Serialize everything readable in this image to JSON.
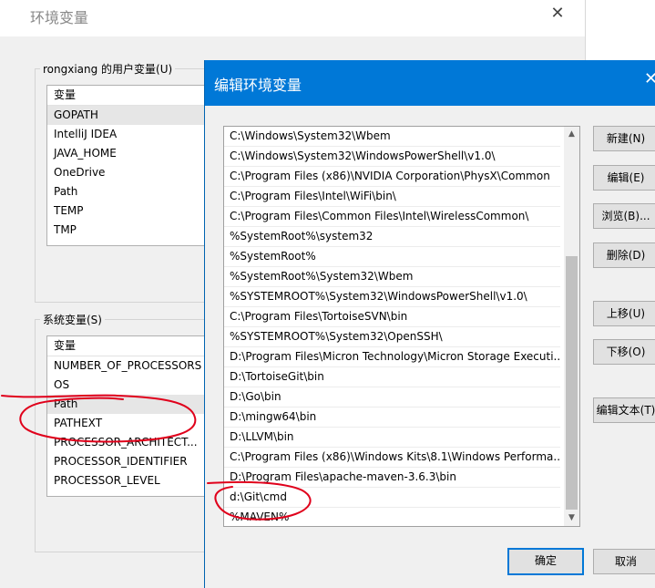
{
  "bg_window": {
    "title": "环境变量",
    "user_vars_label": "rongxiang 的用户变量(U)",
    "user_vars_header": "变量",
    "user_vars": [
      "GOPATH",
      "IntelliJ IDEA",
      "JAVA_HOME",
      "OneDrive",
      "Path",
      "TEMP",
      "TMP"
    ],
    "sys_vars_label": "系统变量(S)",
    "sys_vars_header": "变量",
    "sys_vars": [
      "NUMBER_OF_PROCESSORS",
      "OS",
      "Path",
      "PATHEXT",
      "PROCESSOR_ARCHITECT...",
      "PROCESSOR_IDENTIFIER",
      "PROCESSOR_LEVEL"
    ]
  },
  "dialog": {
    "title": "编辑环境变量",
    "paths": [
      "C:\\Windows\\System32\\Wbem",
      "C:\\Windows\\System32\\WindowsPowerShell\\v1.0\\",
      "C:\\Program Files (x86)\\NVIDIA Corporation\\PhysX\\Common",
      "C:\\Program Files\\Intel\\WiFi\\bin\\",
      "C:\\Program Files\\Common Files\\Intel\\WirelessCommon\\",
      "%SystemRoot%\\system32",
      "%SystemRoot%",
      "%SystemRoot%\\System32\\Wbem",
      "%SYSTEMROOT%\\System32\\WindowsPowerShell\\v1.0\\",
      "C:\\Program Files\\TortoiseSVN\\bin",
      "%SYSTEMROOT%\\System32\\OpenSSH\\",
      "D:\\Program Files\\Micron Technology\\Micron Storage Executi...",
      "D:\\TortoiseGit\\bin",
      "D:\\Go\\bin",
      "D:\\mingw64\\bin",
      "D:\\LLVM\\bin",
      "C:\\Program Files (x86)\\Windows Kits\\8.1\\Windows Performa...",
      "D:\\Program Files\\apache-maven-3.6.3\\bin",
      "d:\\Git\\cmd",
      "%MAVEN%"
    ],
    "buttons": {
      "new": "新建(N)",
      "edit": "编辑(E)",
      "browse": "浏览(B)...",
      "delete": "删除(D)",
      "move_up": "上移(U)",
      "move_down": "下移(O)",
      "edit_text": "编辑文本(T)",
      "ok": "确定",
      "cancel": "取消"
    }
  },
  "colors": {
    "dialog_titlebar": "#0078d7",
    "annotation": "#e0001b"
  },
  "icons": {
    "close": "close-icon",
    "scroll_up": "chevron-up-icon",
    "scroll_down": "chevron-down-icon"
  }
}
